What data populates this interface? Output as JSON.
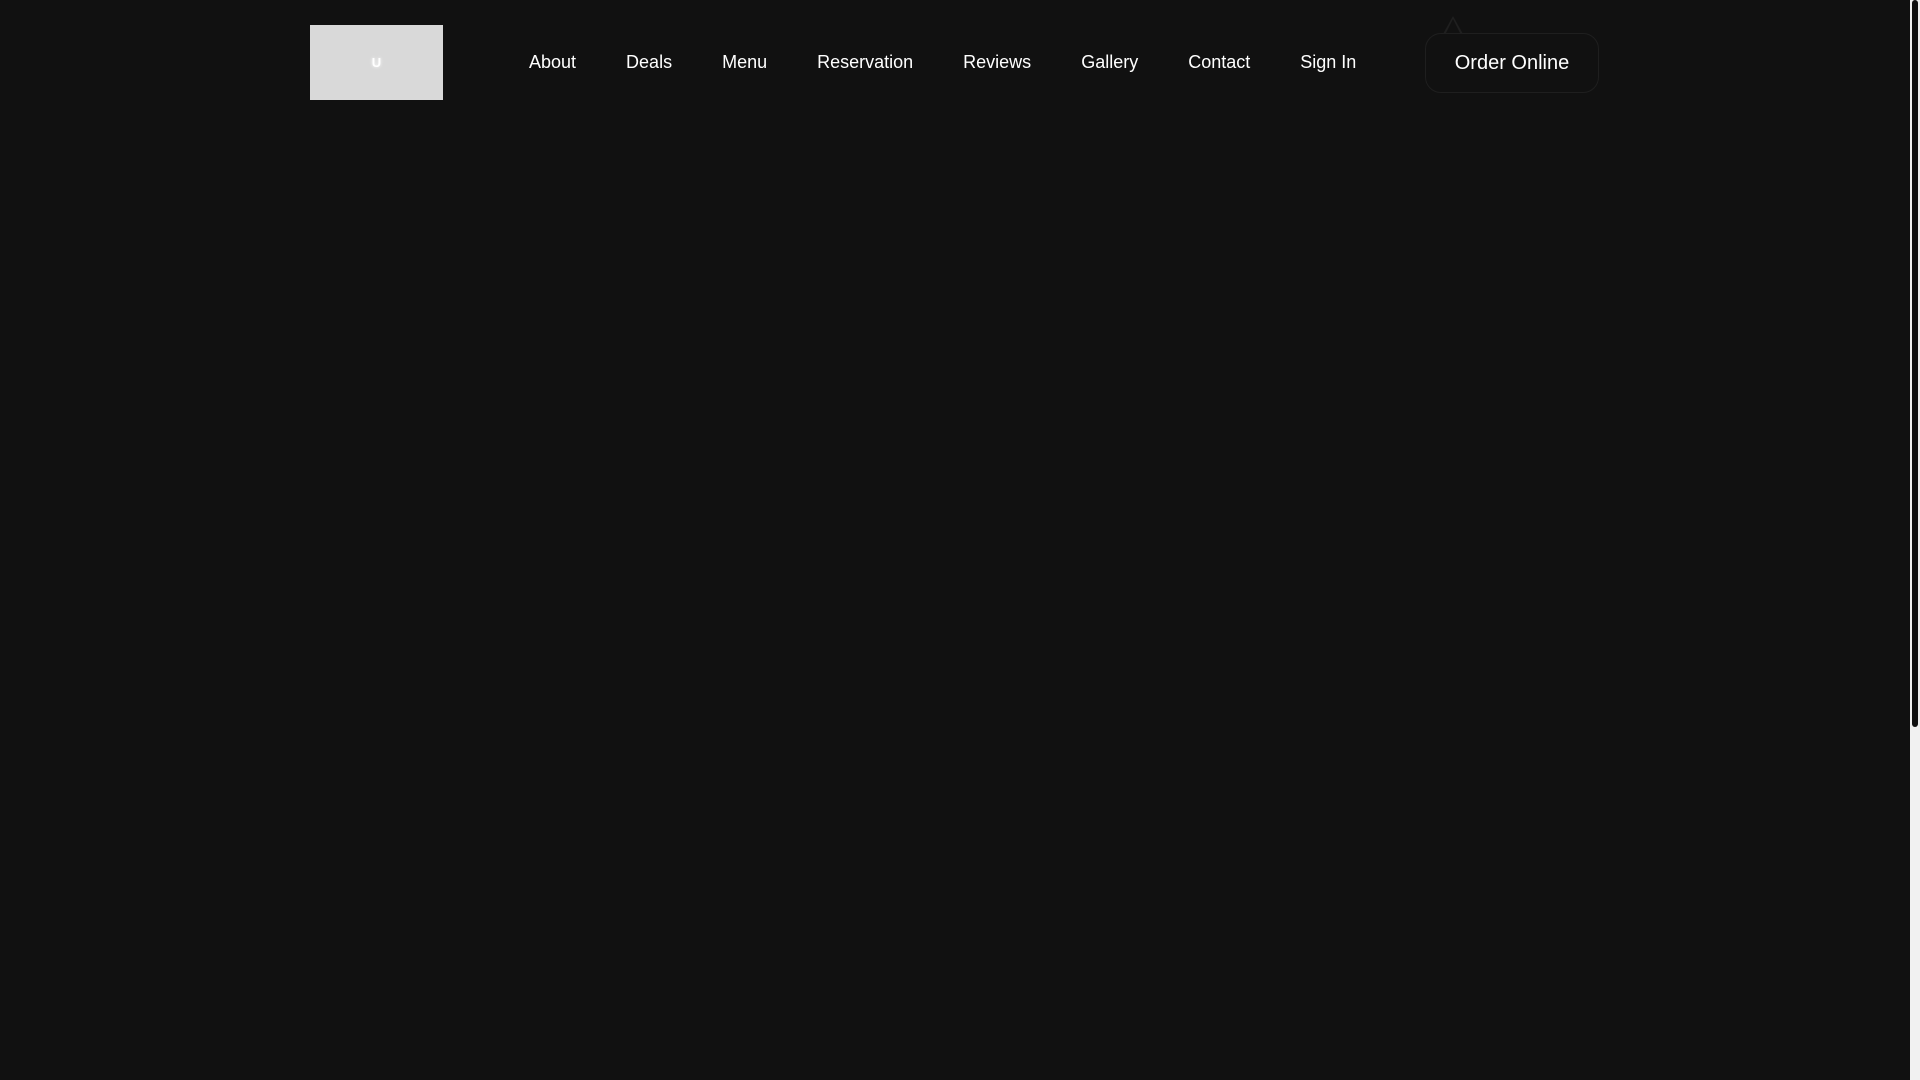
{
  "header": {
    "logo_text": "U",
    "nav_items": [
      {
        "id": "about",
        "label": "About"
      },
      {
        "id": "deals",
        "label": "Deals"
      },
      {
        "id": "menu",
        "label": "Menu"
      },
      {
        "id": "reservation",
        "label": "Reservation"
      },
      {
        "id": "reviews",
        "label": "Reviews"
      },
      {
        "id": "gallery",
        "label": "Gallery"
      },
      {
        "id": "contact",
        "label": "Contact"
      },
      {
        "id": "sign-in",
        "label": "Sign In"
      }
    ],
    "order_button_label": "Order Online"
  },
  "colors": {
    "background": "#111111",
    "text": "#ffffff",
    "logo_background": "#d9d9d9"
  }
}
